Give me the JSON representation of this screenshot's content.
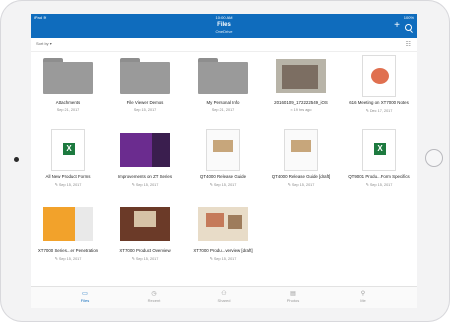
{
  "device": {
    "status_left": "iPad ≋",
    "clock": "10:00 AM",
    "status_right": "100%"
  },
  "header": {
    "title": "Files",
    "subtitle": "OneDrive",
    "add_label": "+",
    "search_icon": "search-icon"
  },
  "sort": {
    "label": "Sort by ▾",
    "view_icon": "☷"
  },
  "items": [
    {
      "name": "Attachments",
      "meta": "Sep 21, 2017",
      "kind": "folder"
    },
    {
      "name": "File Viewer Demos",
      "meta": "Sep 15, 2017",
      "kind": "folder"
    },
    {
      "name": "My Personal Info",
      "meta": "Sep 21, 2017",
      "kind": "folder"
    },
    {
      "name": "20160109_172222549_iOS",
      "meta": "≈ 19 hrs ago",
      "kind": "photo"
    },
    {
      "name": "616 Meeting on XT7000 Notes",
      "meta": "✎ Dec 17, 2017",
      "kind": "doc-red"
    },
    {
      "name": "All New Product Forms",
      "meta": "✎ Sep 15, 2017",
      "kind": "excel"
    },
    {
      "name": "Improvements on ZT Series",
      "meta": "✎ Sep 15, 2017",
      "kind": "purple"
    },
    {
      "name": "QT4000 Release Guide",
      "meta": "✎ Sep 15, 2017",
      "kind": "doc"
    },
    {
      "name": "QT4000 Release Guide [draft]",
      "meta": "✎ Sep 15, 2017",
      "kind": "doc"
    },
    {
      "name": "QT9001 Produ...Form Specifics",
      "meta": "✎ Sep 15, 2017",
      "kind": "excel"
    },
    {
      "name": "XT7000 Series...er Penetration",
      "meta": "✎ Sep 15, 2017",
      "kind": "orange"
    },
    {
      "name": "XT7000 Product Overview",
      "meta": "✎ Sep 15, 2017",
      "kind": "brown"
    },
    {
      "name": "XT7000 Produ...verview [draft]",
      "meta": "✎ Sep 15, 2017",
      "kind": "beige"
    }
  ],
  "tabbar": [
    {
      "label": "Files",
      "icon": "folder-icon"
    },
    {
      "label": "Recent",
      "icon": "clock-icon"
    },
    {
      "label": "Shared",
      "icon": "people-icon"
    },
    {
      "label": "Photos",
      "icon": "photo-icon"
    },
    {
      "label": "Me",
      "icon": "person-icon"
    }
  ]
}
